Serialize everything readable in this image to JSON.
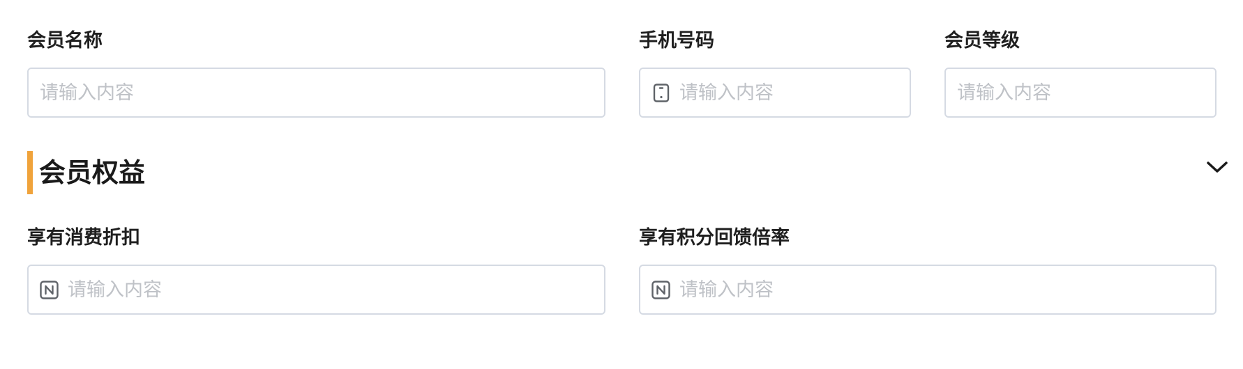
{
  "member_info": {
    "name": {
      "label": "会员名称",
      "placeholder": "请输入内容",
      "value": ""
    },
    "phone": {
      "label": "手机号码",
      "placeholder": "请输入内容",
      "value": "",
      "icon": "mobile-phone-icon"
    },
    "level": {
      "label": "会员等级",
      "placeholder": "请输入内容",
      "value": ""
    }
  },
  "benefits_section": {
    "title": "会员权益",
    "accent_color": "#f0a33b",
    "toggle_icon": "chevron-down-icon",
    "discount": {
      "label": "享有消费折扣",
      "placeholder": "请输入内容",
      "value": "",
      "icon": "number-icon"
    },
    "points_rate": {
      "label": "享有积分回馈倍率",
      "placeholder": "请输入内容",
      "value": "",
      "icon": "number-icon"
    }
  }
}
